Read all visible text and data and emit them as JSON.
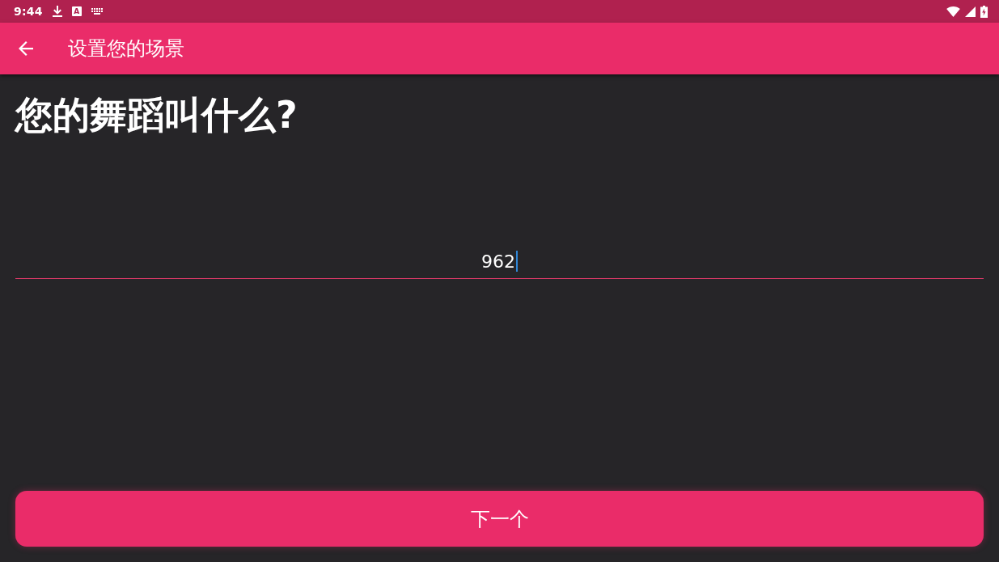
{
  "status_bar": {
    "time": "9:44",
    "keyboard_badge": "A"
  },
  "app_bar": {
    "title": "设置您的场景"
  },
  "question": "您的舞蹈叫什么?",
  "name_field": {
    "value": "962",
    "focused": true
  },
  "buttons": [
    {
      "label": "下一个"
    }
  ]
}
